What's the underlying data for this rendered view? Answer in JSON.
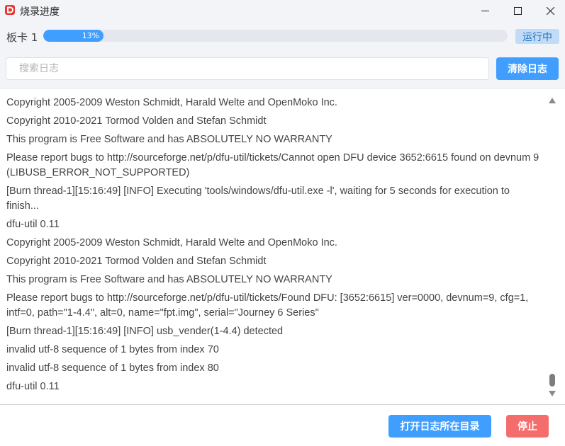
{
  "window": {
    "title": "烧录进度",
    "logo_icon": "app-logo-icon",
    "controls": {
      "minimize_icon": "minimize-icon",
      "maximize_icon": "maximize-icon",
      "close_icon": "close-icon"
    }
  },
  "header": {
    "board_label": "板卡 1",
    "progress": {
      "value": 13,
      "label": "13%"
    },
    "status": "运行中"
  },
  "search": {
    "placeholder": "搜索日志",
    "value": ""
  },
  "toolbar": {
    "clear_label": "清除日志"
  },
  "log": {
    "lines": [
      "Copyright 2005-2009 Weston Schmidt, Harald Welte and OpenMoko Inc.",
      "Copyright 2010-2021 Tormod Volden and Stefan Schmidt",
      "This program is Free Software and has ABSOLUTELY NO WARRANTY",
      "Please report bugs to http://sourceforge.net/p/dfu-util/tickets/Cannot open DFU device 3652:6615 found on devnum 9 (LIBUSB_ERROR_NOT_SUPPORTED)",
      "[Burn thread-1][15:16:49] [INFO] Executing 'tools/windows/dfu-util.exe -l', waiting for 5 seconds for execution to finish...",
      "dfu-util 0.11",
      "Copyright 2005-2009 Weston Schmidt, Harald Welte and OpenMoko Inc.",
      "Copyright 2010-2021 Tormod Volden and Stefan Schmidt",
      "This program is Free Software and has ABSOLUTELY NO WARRANTY",
      "Please report bugs to http://sourceforge.net/p/dfu-util/tickets/Found DFU: [3652:6615] ver=0000, devnum=9, cfg=1, intf=0, path=\"1-4.4\", alt=0, name=\"fpt.img\", serial=\"Journey 6 Series\"",
      "[Burn thread-1][15:16:49] [INFO] usb_vender(1-4.4) detected",
      "invalid utf-8 sequence of 1 bytes from index 70",
      "invalid utf-8 sequence of 1 bytes from index 80",
      "dfu-util 0.11"
    ]
  },
  "footer": {
    "open_dir_label": "打开日志所在目录",
    "stop_label": "停止"
  },
  "colors": {
    "accent": "#409eff",
    "danger": "#f56c6c",
    "status_bg": "#c2dcf7",
    "status_text": "#1f6fc4"
  }
}
